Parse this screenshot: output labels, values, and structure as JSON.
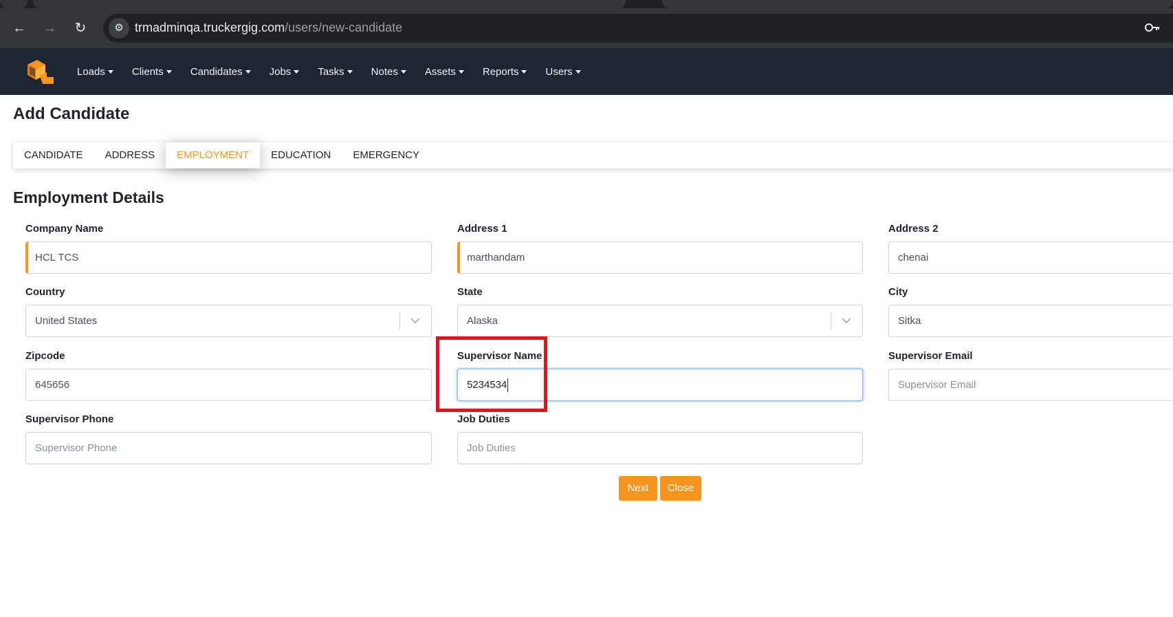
{
  "browser": {
    "url_host": "trmadminqa.truckergig.com",
    "url_path": "/users/new-candidate"
  },
  "nav": {
    "items": [
      {
        "label": "Loads"
      },
      {
        "label": "Clients"
      },
      {
        "label": "Candidates"
      },
      {
        "label": "Jobs"
      },
      {
        "label": "Tasks"
      },
      {
        "label": "Notes"
      },
      {
        "label": "Assets"
      },
      {
        "label": "Reports"
      },
      {
        "label": "Users"
      }
    ]
  },
  "page": {
    "title": "Add Candidate",
    "section_title": "Employment Details"
  },
  "tabs": [
    {
      "label": "CANDIDATE"
    },
    {
      "label": "ADDRESS"
    },
    {
      "label": "EMPLOYMENT",
      "active": true
    },
    {
      "label": "EDUCATION"
    },
    {
      "label": "EMERGENCY"
    }
  ],
  "form": {
    "company_name": {
      "label": "Company Name",
      "value": "HCL TCS"
    },
    "address1": {
      "label": "Address 1",
      "value": "marthandam"
    },
    "address2": {
      "label": "Address 2",
      "value": "chenai"
    },
    "country": {
      "label": "Country",
      "value": "United States"
    },
    "state": {
      "label": "State",
      "value": "Alaska"
    },
    "city": {
      "label": "City",
      "value": "Sitka"
    },
    "zipcode": {
      "label": "Zipcode",
      "value": "645656"
    },
    "supervisor_name": {
      "label": "Supervisor Name",
      "value": "5234534"
    },
    "supervisor_email": {
      "label": "Supervisor Email",
      "placeholder": "Supervisor Email"
    },
    "supervisor_phone": {
      "label": "Supervisor Phone",
      "placeholder": "Supervisor Phone"
    },
    "job_duties": {
      "label": "Job Duties",
      "placeholder": "Job Duties"
    }
  },
  "buttons": {
    "next": "Next",
    "close": "Close"
  },
  "colors": {
    "accent": "#f7941d",
    "navbar": "#1e2633",
    "highlight": "#e4131b"
  }
}
